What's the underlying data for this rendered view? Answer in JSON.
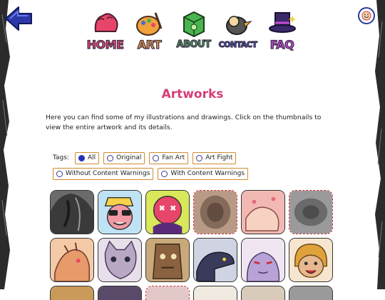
{
  "nav": {
    "items": [
      {
        "label": "HOME",
        "color": "#e8456a"
      },
      {
        "label": "ART",
        "color": "#f2a23b"
      },
      {
        "label": "ABOUT",
        "color": "#48b54e"
      },
      {
        "label": "CONTACT",
        "color": "#3e6ad8"
      },
      {
        "label": "FAQ",
        "color": "#c74bd0"
      }
    ]
  },
  "page": {
    "title": "Artworks",
    "intro": "Here you can find some of my illustrations and drawings. Click on the thumbnails to view the entire artwork and its details."
  },
  "tags": {
    "label": "Tags:",
    "options": [
      {
        "label": "All",
        "selected": true
      },
      {
        "label": "Original",
        "selected": false
      },
      {
        "label": "Fan Art",
        "selected": false
      },
      {
        "label": "Art Fight",
        "selected": false
      },
      {
        "label": "Without Content Warnings",
        "selected": false
      },
      {
        "label": "With Content Warnings",
        "selected": false
      }
    ]
  },
  "thumbnails": [
    {
      "icon": "dark-figure-artwork",
      "content_warning": false
    },
    {
      "icon": "sunglasses-character-artwork",
      "content_warning": false
    },
    {
      "icon": "pink-skull-character-artwork",
      "content_warning": false
    },
    {
      "icon": "blurred-artwork",
      "content_warning": true
    },
    {
      "icon": "pink-creature-artwork",
      "content_warning": false
    },
    {
      "icon": "blurred-artwork",
      "content_warning": true
    },
    {
      "icon": "dragon-artwork",
      "content_warning": false
    },
    {
      "icon": "cat-character-artwork",
      "content_warning": false
    },
    {
      "icon": "wooden-creature-artwork",
      "content_warning": false
    },
    {
      "icon": "dark-dragon-artwork",
      "content_warning": false
    },
    {
      "icon": "purple-character-artwork",
      "content_warning": false
    },
    {
      "icon": "blonde-character-artwork",
      "content_warning": false
    }
  ],
  "colors": {
    "title": "#d63c78",
    "tag_border": "#d28a2e",
    "radio_selected": "#2331b8",
    "warning_border": "#c9323e",
    "back_arrow": "#2d38a8"
  }
}
